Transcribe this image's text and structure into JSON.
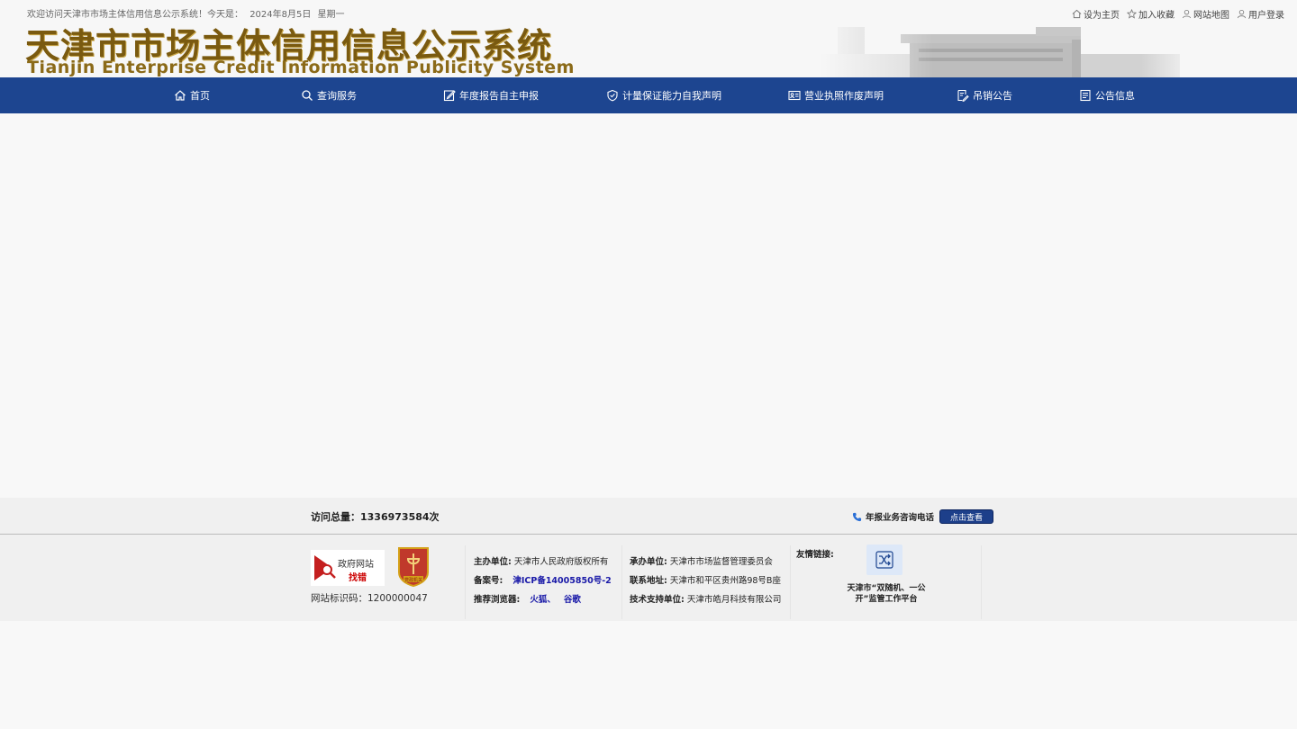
{
  "header": {
    "welcome_text": "欢迎访问天津市市场主体信用信息公示系统！今天是：",
    "date": "2024年8月5日",
    "weekday": "星期一",
    "title_cn": "天津市市场主体信用信息公示系统",
    "title_en": "Tianjin Enterprise Credit Information Publicity System",
    "top_links": [
      {
        "label": "设为主页",
        "icon": "home-outline-icon"
      },
      {
        "label": "加入收藏",
        "icon": "star-icon"
      },
      {
        "label": "网站地图",
        "icon": "map-person-icon"
      },
      {
        "label": "用户登录",
        "icon": "user-icon"
      }
    ]
  },
  "nav": {
    "bg_color": "#1d4590",
    "items": [
      {
        "label": "首页",
        "icon": "home-icon"
      },
      {
        "label": "查询服务",
        "icon": "search-icon"
      },
      {
        "label": "年度报告自主申报",
        "icon": "edit-icon"
      },
      {
        "label": "计量保证能力自我声明",
        "icon": "shield-check-icon"
      },
      {
        "label": "营业执照作废声明",
        "icon": "id-card-icon"
      },
      {
        "label": "吊销公告",
        "icon": "document-edit-icon"
      },
      {
        "label": "公告信息",
        "icon": "document-list-icon"
      }
    ]
  },
  "stats": {
    "visits_label": "访问总量：",
    "visits_value": "1336973584次",
    "hotline_label": "年报业务咨询电话",
    "view_button": "点击查看"
  },
  "footer": {
    "gov_badge_line1": "政府网站",
    "gov_badge_line2": "找错",
    "party_badge_text": "党政机关",
    "site_code_label": "网站标识码：",
    "site_code": "1200000047",
    "host_label": "主办单位:",
    "host_value": "天津市人民政府版权所有",
    "record_label": "备案号:",
    "record_value": "津ICP备14005850号-2",
    "browser_label": "推荐浏览器:",
    "browser_firefox": "火狐、",
    "browser_google": "谷歌",
    "organizer_label": "承办单位:",
    "organizer_value": "天津市市场监督管理委员会",
    "address_label": "联系地址:",
    "address_value": "天津市和平区贵州路98号B座",
    "tech_label": "技术支持单位:",
    "tech_value": "天津市皓月科技有限公司",
    "friend_label": "友情链接:",
    "friend_link": "天津市“双随机、一公开”监管工作平台"
  }
}
